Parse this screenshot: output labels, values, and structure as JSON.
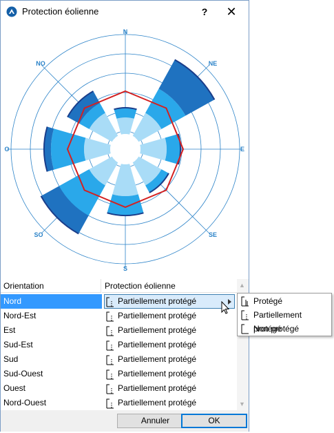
{
  "window": {
    "title": "Protection éolienne",
    "help_label": "?",
    "close_label": "✕"
  },
  "rose": {
    "directions": [
      "N",
      "NE",
      "E",
      "SE",
      "S",
      "SO",
      "O",
      "NO"
    ],
    "colors": {
      "ring": "#2a82c8",
      "sector_light": "#a9dcf7",
      "sector_mid": "#2aa8ea",
      "sector_dark": "#1f72c0",
      "sector_outline": "#1a3d8a",
      "octagon": "#d42020",
      "label": "#2a82c8"
    }
  },
  "grid": {
    "headers": {
      "orientation": "Orientation",
      "protection": "Protection éolienne"
    },
    "rows": [
      {
        "orientation": "Nord",
        "protection": "Partiellement protégé",
        "selected": true
      },
      {
        "orientation": "Nord-Est",
        "protection": "Partiellement protégé"
      },
      {
        "orientation": "Est",
        "protection": "Partiellement protégé"
      },
      {
        "orientation": "Sud-Est",
        "protection": "Partiellement protégé"
      },
      {
        "orientation": "Sud",
        "protection": "Partiellement protégé"
      },
      {
        "orientation": "Sud-Ouest",
        "protection": "Partiellement protégé"
      },
      {
        "orientation": "Ouest",
        "protection": "Partiellement protégé"
      },
      {
        "orientation": "Nord-Ouest",
        "protection": "Partiellement protégé"
      }
    ]
  },
  "submenu": {
    "items": [
      "Protégé",
      "Partiellement protégé",
      "Non protégé"
    ]
  },
  "footer": {
    "cancel_label": "Annuler",
    "ok_label": "OK"
  }
}
